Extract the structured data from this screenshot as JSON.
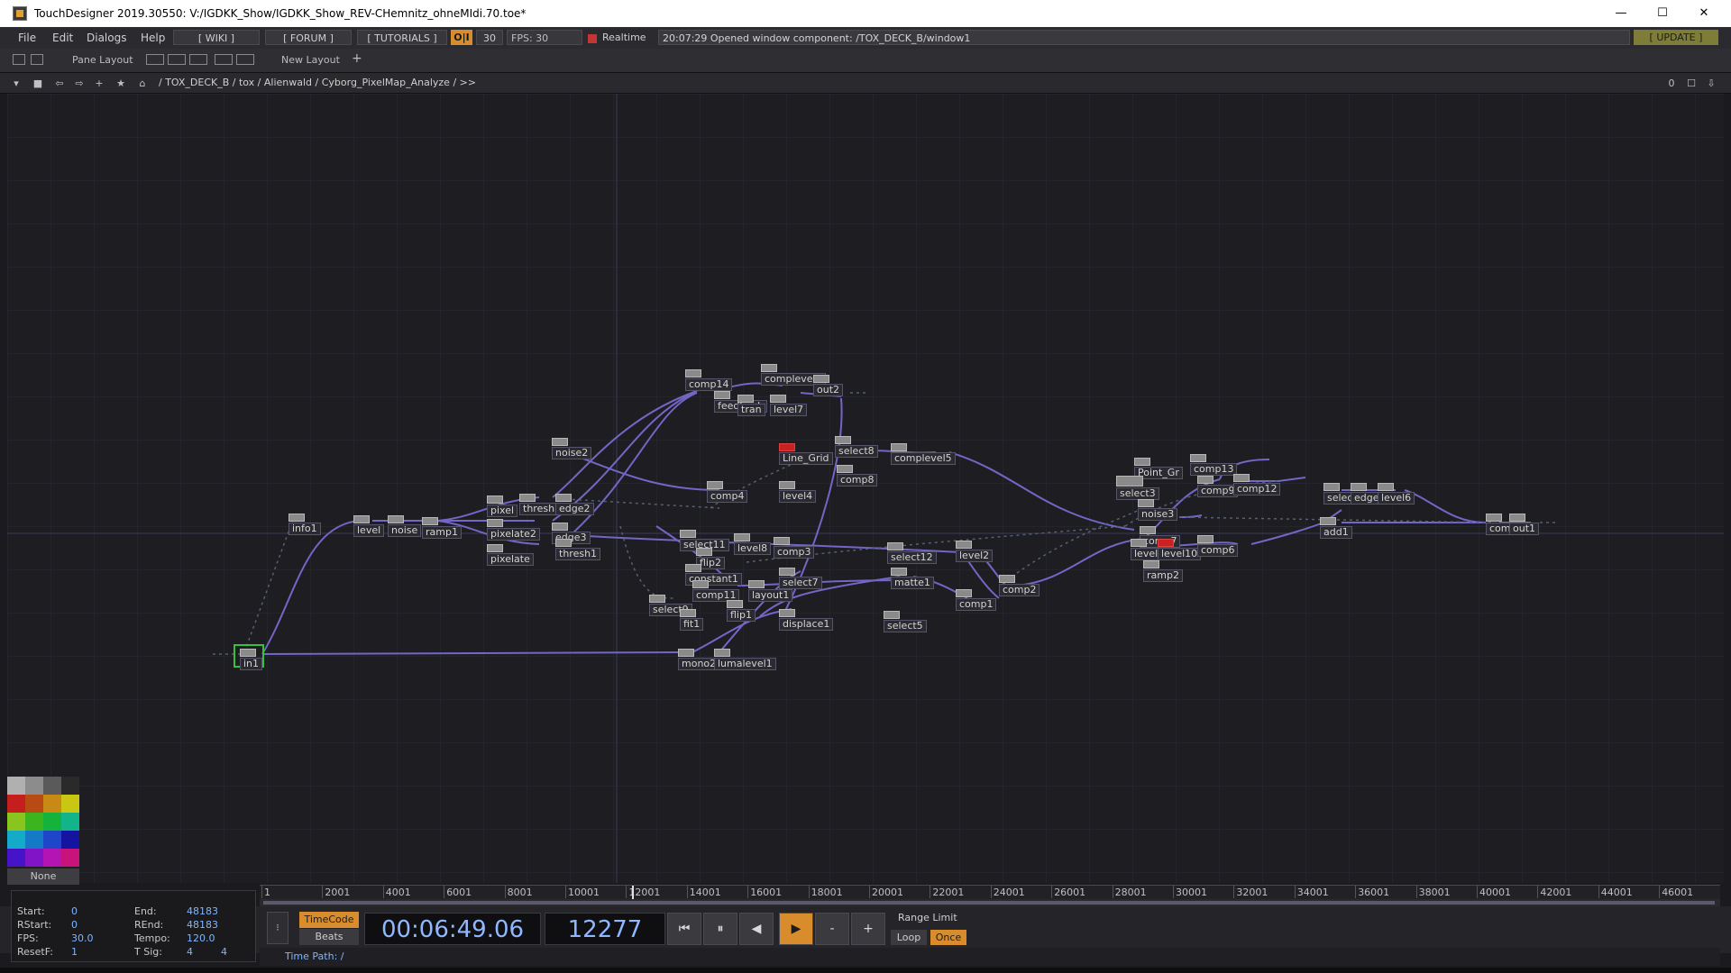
{
  "window": {
    "title": "TouchDesigner 2019.30550: V:/IGDKK_Show/IGDKK_Show_REV-CHemnitz_ohneMIdi.70.toe*",
    "minimize_glyph": "—",
    "maximize_glyph": "☐",
    "close_glyph": "✕"
  },
  "menu": {
    "items": [
      "File",
      "Edit",
      "Dialogs",
      "Help"
    ],
    "wiki": "[ WIKI ]",
    "forum": "[ FORUM ]",
    "tutorials": "[ TUTORIALS ]",
    "oi": "O|I",
    "thirty": "30",
    "fps": "FPS: 30",
    "realtime": "Realtime",
    "status": "20:07:29 Opened window component: /TOX_DECK_B/window1",
    "update": "[ UPDATE ]"
  },
  "pane": {
    "pane_layout": "Pane Layout",
    "new_layout": "New Layout",
    "plus": "+"
  },
  "path": {
    "text": "/ TOX_DECK_B / tox / Alienwald / Cyborg_PixelMap_Analyze / >>",
    "zero": "0"
  },
  "network": {
    "colors": {
      "wire": "#7466c6",
      "wire_dark": "#5a4f9a",
      "selected": "#2fc43a",
      "error": "#c82222"
    },
    "operators": [
      "info1",
      "level",
      "noise",
      "ramp1",
      "in1",
      "pixel",
      "thresh",
      "edge2",
      "pixelate2",
      "edge3",
      "pixelate",
      "thresh1",
      "noise2",
      "comp14",
      "complevel1",
      "out2",
      "feedback",
      "tran",
      "level7",
      "Line_Grid",
      "select8",
      "complevel5",
      "comp8",
      "comp4",
      "level4",
      "select11",
      "level8",
      "comp3",
      "flip2",
      "constant1",
      "comp11",
      "layout1",
      "select9",
      "flip1",
      "fit1",
      "select7",
      "displace1",
      "select12",
      "level2",
      "matte1",
      "comp2",
      "comp1",
      "select5",
      "mono2",
      "lumalevel1",
      "Point_Gr",
      "comp13",
      "select3",
      "comp9",
      "comp12",
      "noise3",
      "comp7",
      "level",
      "level10",
      "ramp2",
      "comp6",
      "select",
      "edge",
      "level6",
      "add1",
      "comp",
      "out1"
    ]
  },
  "palette": {
    "colors": [
      "#b0b0b0",
      "#8c8c8c",
      "#5a5a5a",
      "#2a2a2a",
      "#c41e1e",
      "#b84a14",
      "#c88a14",
      "#c8c814",
      "#8ac41e",
      "#3cb41e",
      "#14b43c",
      "#14b48a",
      "#14aac8",
      "#147ac8",
      "#1e46c8",
      "#1414a0",
      "#4614c8",
      "#8214c8",
      "#b414b4",
      "#c8147a"
    ],
    "none_label": "None"
  },
  "timeline": {
    "ticks": [
      "1",
      "2001",
      "4001",
      "6001",
      "8001",
      "10001",
      "12001",
      "14001",
      "16001",
      "18001",
      "20001",
      "22001",
      "24001",
      "26001",
      "28001",
      "30001",
      "32001",
      "34001",
      "36001",
      "38001",
      "40001",
      "42001",
      "44001",
      "46001"
    ],
    "start_label": "Start:",
    "start": "0",
    "end_label": "End:",
    "end": "48183",
    "rstart_label": "RStart:",
    "rstart": "0",
    "rend_label": "REnd:",
    "rend": "48183",
    "fps_label": "FPS:",
    "fps": "30.0",
    "tempo_label": "Tempo:",
    "tempo": "120.0",
    "resetf_label": "ResetF:",
    "resetf": "1",
    "tsig_label": "T Sig:",
    "tsig_a": "4",
    "tsig_b": "4",
    "timecode_btn": "TimeCode",
    "beats_btn": "Beats",
    "time_display": "00:06:49.06",
    "frame_display": "12277",
    "ctrl_rewind": "⏮",
    "ctrl_pause": "⏸",
    "ctrl_back": "◀",
    "ctrl_play": "▶",
    "ctrl_minus": "-",
    "ctrl_plus": "+",
    "range_limit": "Range Limit",
    "loop": "Loop",
    "once": "Once",
    "time_path": "Time Path: /",
    "ruler_fill": 0.2548
  }
}
